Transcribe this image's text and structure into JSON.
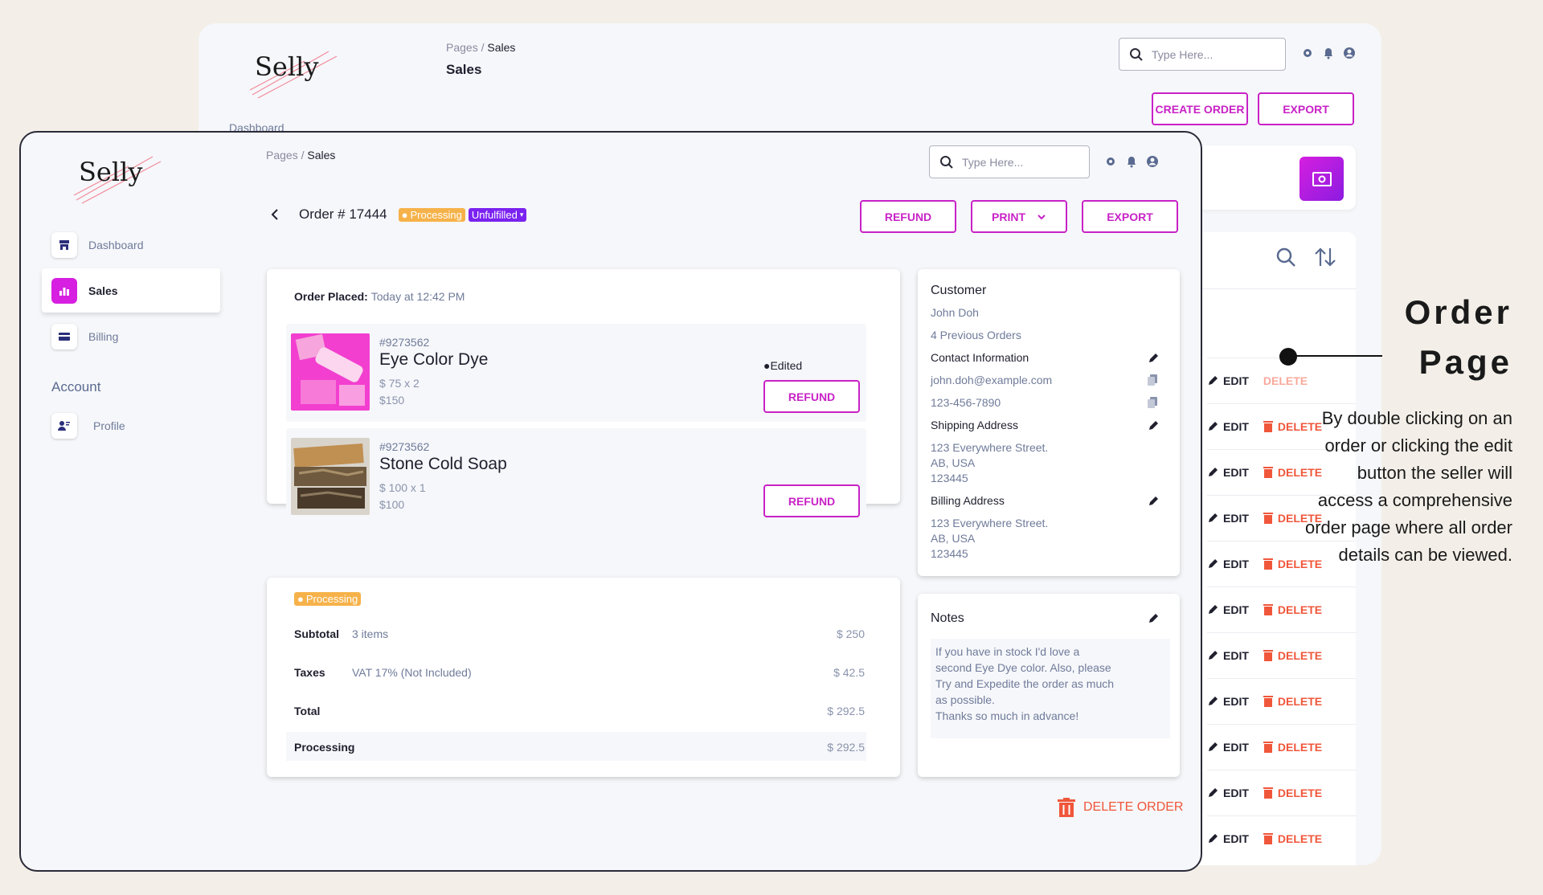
{
  "background_window": {
    "logo": "Selly",
    "breadcrumb_root": "Pages /",
    "breadcrumb_current": "Sales",
    "page_title": "Sales",
    "nav_first_item": "Dashboard",
    "search_placeholder": "Type Here...",
    "create_order_label": "CREATE ORDER",
    "export_label": "EXPORT",
    "row_edit_label": "EDIT",
    "row_delete_label": "DELETE"
  },
  "annotation": {
    "title": "Order Page",
    "description": "By double clicking on an order or clicking the edit button the seller will access a comprehensive order page where all order details can be viewed."
  },
  "app": {
    "logo": "Selly",
    "sidebar": {
      "items": [
        {
          "label": "Dashboard",
          "icon": "store-icon"
        },
        {
          "label": "Sales",
          "icon": "bar-chart-icon",
          "active": true
        },
        {
          "label": "Billing",
          "icon": "credit-card-icon"
        }
      ],
      "section_label": "Account",
      "account_items": [
        {
          "label": "Profile",
          "icon": "profile-icon"
        }
      ]
    },
    "header": {
      "breadcrumb_root": "Pages /",
      "breadcrumb_current": "Sales",
      "search_placeholder": "Type Here..."
    },
    "order": {
      "title": "Order # 17444",
      "status_processing": "Processing",
      "status_unfulfilled": "Unfulfilled",
      "refund_label": "REFUND",
      "print_label": "PRINT",
      "export_label": "EXPORT",
      "placed_label": "Order Placed:",
      "placed_value": "Today at 12:42 PM",
      "items": [
        {
          "sku": "#9273562",
          "name": "Eye Color Dye",
          "qty": "$ 75 x 2",
          "price": "$150",
          "edited": "Edited",
          "refund_label": "REFUND"
        },
        {
          "sku": "#9273562",
          "name": "Stone Cold Soap",
          "qty": "$ 100 x 1",
          "price": "$100",
          "refund_label": "REFUND"
        }
      ],
      "summary": {
        "status": "Processing",
        "subtotal_label": "Subtotal",
        "subtotal_detail": "3 items",
        "subtotal_value": "$ 250",
        "taxes_label": "Taxes",
        "taxes_detail": "VAT 17% (Not Included)",
        "taxes_value": "$ 42.5",
        "total_label": "Total",
        "total_value": "$ 292.5",
        "processing_label": "Processing",
        "processing_value": "$ 292.5"
      },
      "customer": {
        "heading": "Customer",
        "name": "John Doh",
        "previous_orders": "4 Previous Orders",
        "contact_heading": "Contact Information",
        "email": "john.doh@example.com",
        "phone": "123-456-7890",
        "shipping_heading": "Shipping Address",
        "shipping_line1": "123 Everywhere Street.",
        "shipping_line2": "AB, USA",
        "shipping_line3": "123445",
        "billing_heading": "Billing Address",
        "billing_line1": "123 Everywhere Street.",
        "billing_line2": "AB, USA",
        "billing_line3": "123445"
      },
      "notes": {
        "heading": "Notes",
        "line1": "If you have in stock I'd love a",
        "line2": "second Eye Dye color. Also, please",
        "line3": "Try and Expedite the order as much",
        "line4": "as possible.",
        "line5": "Thanks so much in advance!"
      },
      "delete_order_label": "DELETE ORDER"
    }
  },
  "colors": {
    "accent": "#c822c6",
    "processing": "#f6b24a",
    "unfulfilled": "#7a22f0",
    "danger": "#f0563a"
  }
}
